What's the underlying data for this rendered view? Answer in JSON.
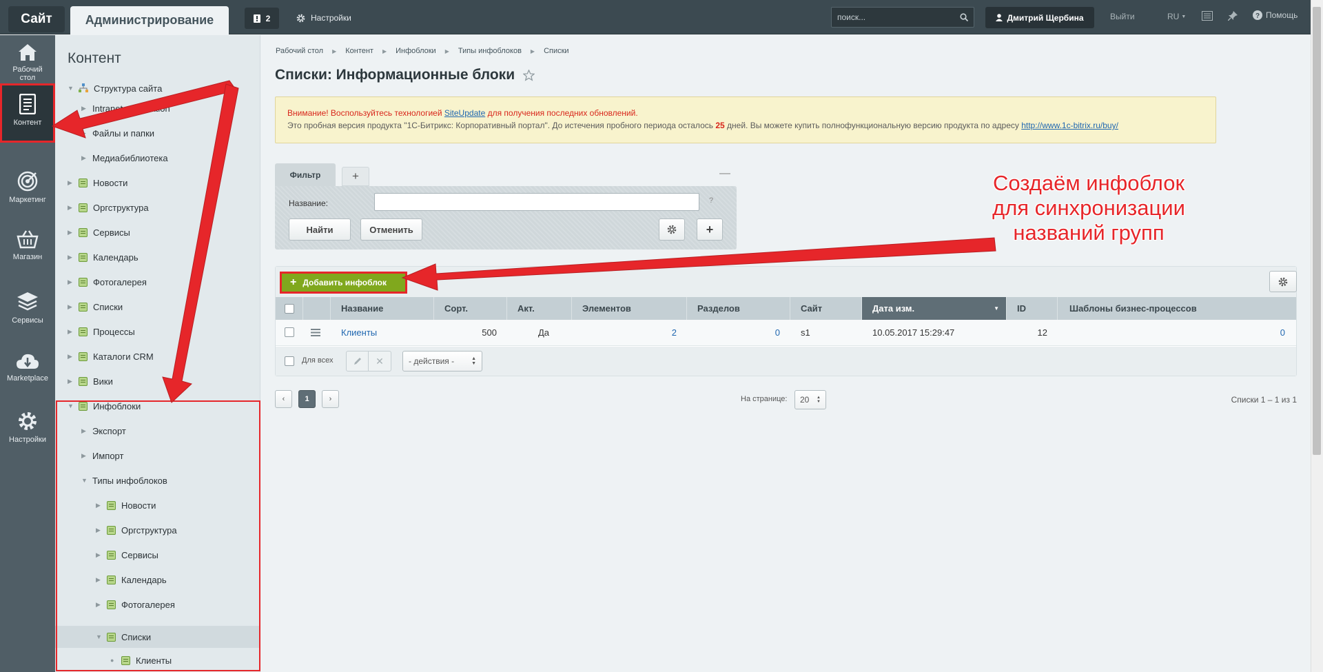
{
  "topbar": {
    "site": "Сайт",
    "admin": "Администрирование",
    "notify_count": "2",
    "settings": "Настройки",
    "search_placeholder": "поиск...",
    "user": "Дмитрий Щербина",
    "logout": "Выйти",
    "lang": "RU",
    "help": "Помощь"
  },
  "rail": [
    {
      "label": "Рабочий стол",
      "icon": "home-icon"
    },
    {
      "label": "Контент",
      "icon": "document-icon"
    },
    {
      "label": "Маркетинг",
      "icon": "target-icon"
    },
    {
      "label": "Магазин",
      "icon": "basket-icon"
    },
    {
      "label": "Сервисы",
      "icon": "layers-icon"
    },
    {
      "label": "Marketplace",
      "icon": "cloud-download-icon"
    },
    {
      "label": "Настройки",
      "icon": "gear-icon"
    }
  ],
  "tree": {
    "title": "Контент",
    "items": [
      "Структура сайта",
      "Intranet corporation",
      "Файлы и папки",
      "Медиабиблиотека",
      "Новости",
      "Оргструктура",
      "Сервисы",
      "Календарь",
      "Фотогалерея",
      "Списки",
      "Процессы",
      "Каталоги CRM",
      "Вики",
      "Инфоблоки",
      "Экспорт",
      "Импорт",
      "Типы инфоблоков",
      "Новости",
      "Оргструктура",
      "Сервисы",
      "Календарь",
      "Фотогалерея",
      "Списки",
      "Клиенты"
    ]
  },
  "breadcrumbs": [
    "Рабочий стол",
    "Контент",
    "Инфоблоки",
    "Типы инфоблоков",
    "Списки"
  ],
  "page_title": "Списки: Информационные блоки",
  "warning": {
    "l1_a": "Внимание! Воспользуйтесь технологией ",
    "l1_link": "SiteUpdate",
    "l1_b": " для получения последних обновлений.",
    "l2_a": "Это пробная версия продукта \"1С-Битрикс: Корпоративный портал\". До истечения пробного периода осталось ",
    "l2_days": "25",
    "l2_b": " дней. Вы можете купить полнофункциональную версию продукта по адресу ",
    "l2_link": "http://www.1c-bitrix.ru/buy/"
  },
  "filter": {
    "tab": "Фильтр",
    "add": "+",
    "label": "Название:",
    "help": "?",
    "find": "Найти",
    "cancel": "Отменить"
  },
  "grid": {
    "add_label": "Добавить инфоблок",
    "columns": [
      "Название",
      "Сорт.",
      "Акт.",
      "Элементов",
      "Разделов",
      "Сайт",
      "Дата изм.",
      "ID",
      "Шаблоны бизнес-процессов"
    ],
    "row": {
      "name": "Клиенты",
      "sort": "500",
      "active": "Да",
      "elements": "2",
      "sections": "0",
      "site": "s1",
      "date": "10.05.2017 15:29:47",
      "id": "12",
      "bp": "0"
    },
    "for_all": "Для всех",
    "actions": "- действия -"
  },
  "pager": {
    "prev": "‹",
    "page": "1",
    "next": "›",
    "per_page_label": "На странице:",
    "per_page": "20",
    "summary": "Списки 1 – 1 из 1"
  },
  "annotation": {
    "l1": "Создаём инфоблок",
    "l2": "для синхронизации",
    "l3": "названий групп"
  },
  "colors": {
    "accent_red": "#e6262a",
    "add_green": "#80a81d",
    "topbar": "#3c4a51",
    "rail": "#505e66"
  }
}
